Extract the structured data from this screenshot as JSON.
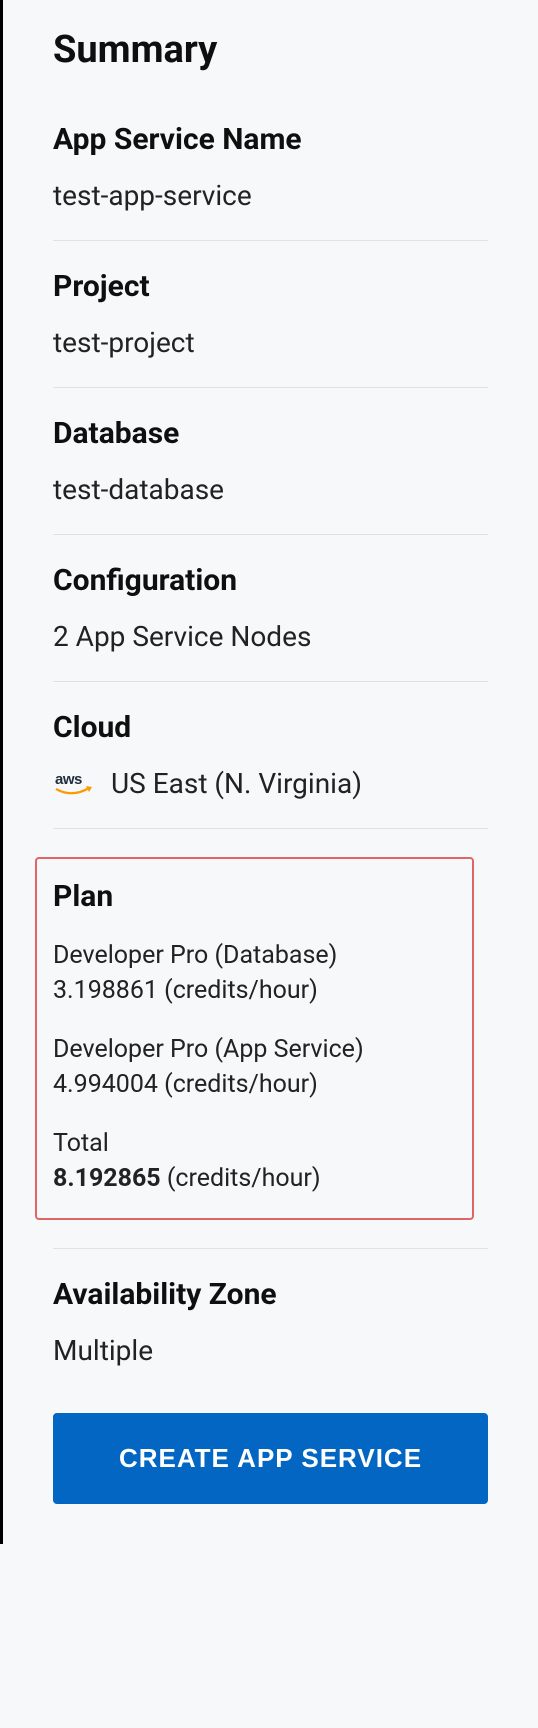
{
  "title": "Summary",
  "sections": {
    "appServiceName": {
      "label": "App Service Name",
      "value": "test-app-service"
    },
    "project": {
      "label": "Project",
      "value": "test-project"
    },
    "database": {
      "label": "Database",
      "value": "test-database"
    },
    "configuration": {
      "label": "Configuration",
      "value": "2 App Service Nodes"
    },
    "cloud": {
      "label": "Cloud",
      "provider": "aws",
      "region": "US East (N. Virginia)"
    },
    "availabilityZone": {
      "label": "Availability Zone",
      "value": "Multiple"
    }
  },
  "plan": {
    "label": "Plan",
    "items": [
      {
        "name": "Developer Pro (Database)",
        "credits": "3.198861",
        "unit": "(credits/hour)"
      },
      {
        "name": "Developer Pro (App Service)",
        "credits": "4.994004",
        "unit": "(credits/hour)"
      }
    ],
    "total": {
      "label": "Total",
      "credits": "8.192865",
      "unit": "(credits/hour)"
    }
  },
  "button": {
    "create": "CREATE APP SERVICE"
  }
}
